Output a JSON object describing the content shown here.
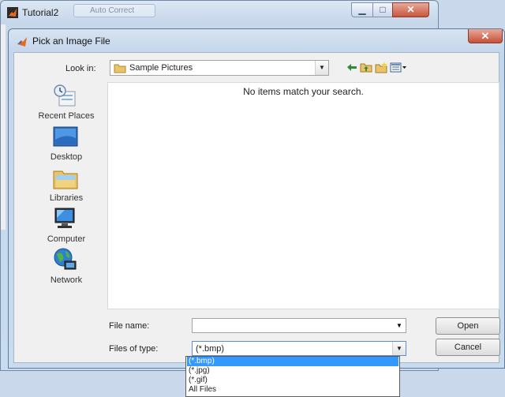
{
  "background_window": {
    "title": "Tutorial2",
    "ghost_title": "Auto Correct",
    "controls": {
      "minimize": "▁",
      "maximize": "□",
      "close": "✕"
    }
  },
  "dialog": {
    "title": "Pick an Image File",
    "close": "✕",
    "look_in": {
      "label": "Look in:",
      "value": "Sample Pictures"
    },
    "toolbar": [
      "back-icon",
      "up-folder-icon",
      "new-folder-icon",
      "view-menu-icon"
    ],
    "places": [
      {
        "label": "Recent Places",
        "icon": "recent-places-icon"
      },
      {
        "label": "Desktop",
        "icon": "desktop-icon"
      },
      {
        "label": "Libraries",
        "icon": "libraries-icon"
      },
      {
        "label": "Computer",
        "icon": "computer-icon"
      },
      {
        "label": "Network",
        "icon": "network-icon"
      }
    ],
    "file_list": {
      "empty_message": "No items match your search."
    },
    "file_name": {
      "label": "File name:",
      "value": ""
    },
    "files_of_type": {
      "label": "Files of type:",
      "value": "(*.bmp)",
      "options": [
        "(*.bmp)",
        "(*.jpg)",
        "(*.gif)",
        "All Files"
      ],
      "selected_index": 0
    },
    "buttons": {
      "open": "Open",
      "cancel": "Cancel"
    }
  },
  "colors": {
    "selection": "#3399ff",
    "close_red": "#c65037",
    "frame": "#c9dbef"
  }
}
